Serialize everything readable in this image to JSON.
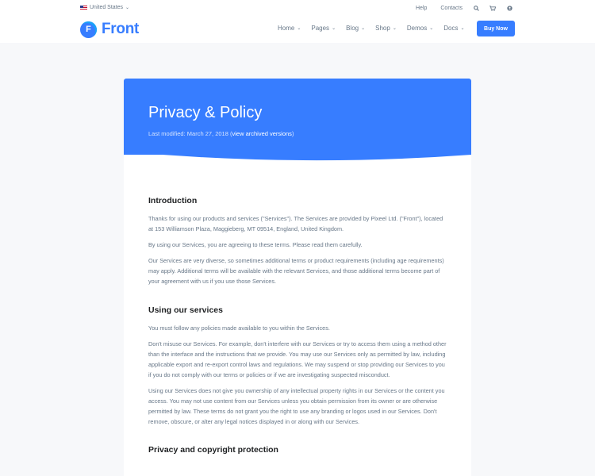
{
  "topbar": {
    "country": "United States",
    "links": [
      "Help",
      "Contacts"
    ],
    "icons": [
      "search-icon",
      "cart-icon",
      "user-icon"
    ]
  },
  "brand": {
    "name": "Front",
    "mark": "F"
  },
  "nav": {
    "items": [
      "Home",
      "Pages",
      "Blog",
      "Shop",
      "Demos",
      "Docs"
    ]
  },
  "buy_button": "Buy Now",
  "hero": {
    "title": "Privacy & Policy",
    "modified_prefix": "Last modified: March 27, 2018 (",
    "archived_link": "view archived versions",
    "modified_suffix": ")"
  },
  "sections": [
    {
      "title": "Introduction",
      "paragraphs": [
        "Thanks for using our products and services (\"Services\"). The Services are provided by Pixeel Ltd. (\"Front\"), located at 153 Williamson Plaza, Maggieberg, MT 09514, England, United Kingdom.",
        "By using our Services, you are agreeing to these terms. Please read them carefully.",
        "Our Services are very diverse, so sometimes additional terms or product requirements (including age requirements) may apply. Additional terms will be available with the relevant Services, and those additional terms become part of your agreement with us if you use those Services."
      ]
    },
    {
      "title": "Using our services",
      "paragraphs": [
        "You must follow any policies made available to you within the Services.",
        "Don't misuse our Services. For example, don't interfere with our Services or try to access them using a method other than the interface and the instructions that we provide. You may use our Services only as permitted by law, including applicable export and re-export control laws and regulations. We may suspend or stop providing our Services to you if you do not comply with our terms or policies or if we are investigating suspected misconduct.",
        "Using our Services does not give you ownership of any intellectual property rights in our Services or the content you access. You may not use content from our Services unless you obtain permission from its owner or are otherwise permitted by law. These terms do not grant you the right to use any branding or logos used in our Services. Don't remove, obscure, or alter any legal notices displayed in or along with our Services."
      ]
    },
    {
      "title": "Privacy and copyright protection",
      "paragraphs": []
    }
  ],
  "colors": {
    "primary": "#377dff",
    "text": "#677788",
    "heading": "#1e2022",
    "background": "#f7f8fa"
  }
}
